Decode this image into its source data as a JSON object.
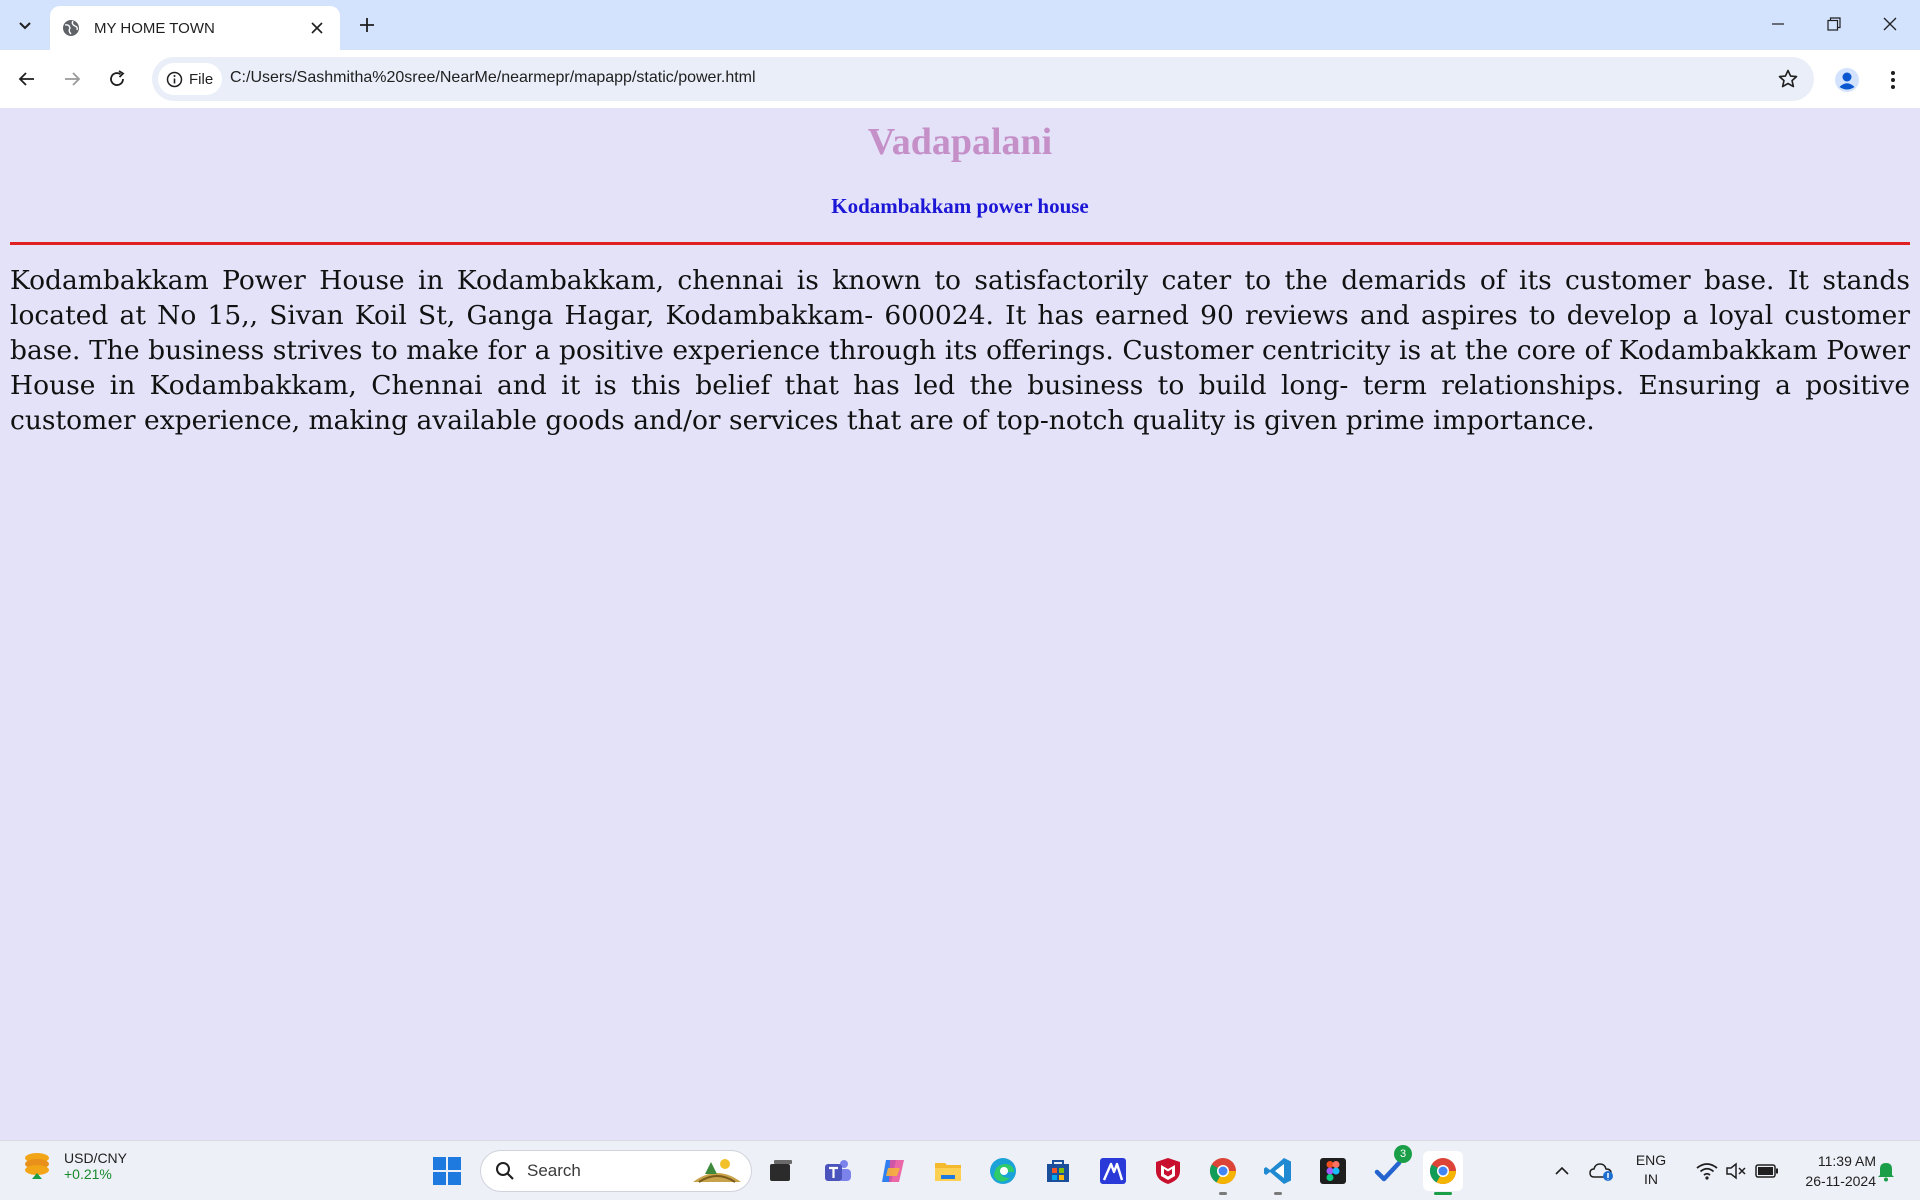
{
  "browser": {
    "tab_title": "MY HOME TOWN",
    "site_chip_label": "File",
    "url": "C:/Users/Sashmitha%20sree/NearMe/nearmepr/mapapp/static/power.html"
  },
  "page": {
    "heading": "Vadapalani",
    "subheading": "Kodambakkam power house",
    "description": "Kodambakkam Power House in Kodambakkam, chennai is known to satisfactorily cater to the demarids of its customer base. It stands located at No 15,, Sivan Koil St, Ganga Hagar, Kodambakkam- 600024. It has earned 90 reviews and aspires to develop a loyal customer base. The business strives to make for a positive experience through its offerings. Customer centricity is at the core of Kodambakkam Power House in Kodambakkam, Chennai and it is this belief that has led the business to build long- term relationships. Ensuring a positive customer experience, making available goods and/or services that are of top-notch quality is given prime importance.",
    "colors": {
      "background": "#e3e2f8",
      "heading": "#c58fc8",
      "subheading": "#1c16d6",
      "rule": "#e02020"
    }
  },
  "taskbar": {
    "widget": {
      "title": "USD/CNY",
      "change": "+0.21%"
    },
    "search_label": "Search",
    "apps": [
      "windows-start-icon",
      "task-view-icon",
      "teams-icon",
      "copilot-icon",
      "file-explorer-icon",
      "edge-icon",
      "store-icon",
      "app-icon",
      "mcafee-icon",
      "chrome-icon",
      "vscode-icon",
      "figma-icon",
      "todo-icon",
      "chrome-active-icon"
    ],
    "todo_badge": "3",
    "language": {
      "line1": "ENG",
      "line2": "IN"
    },
    "clock": {
      "time": "11:39 AM",
      "date": "26-11-2024"
    }
  }
}
